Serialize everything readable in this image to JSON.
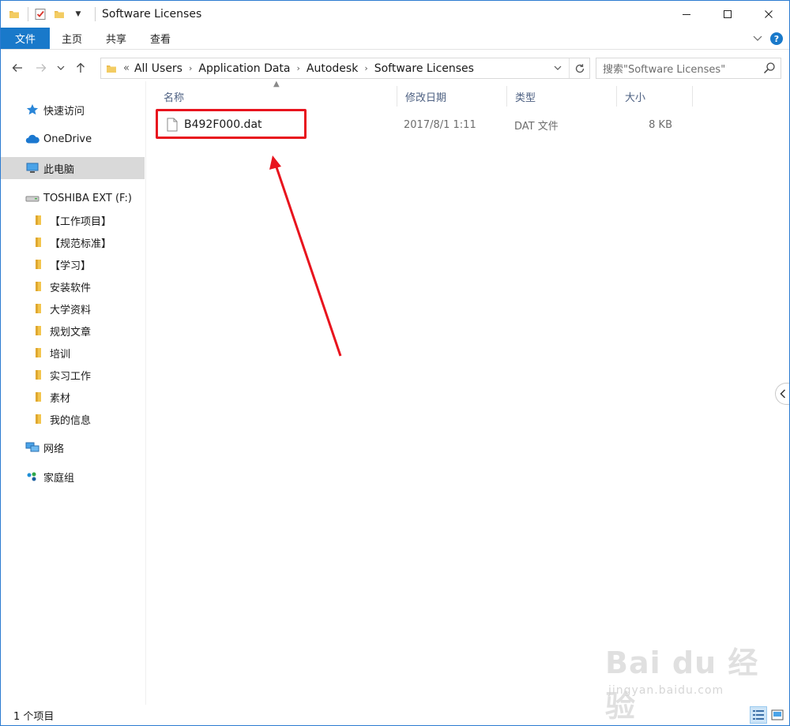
{
  "window": {
    "title": "Software Licenses",
    "controls": [
      "minimize",
      "maximize",
      "close"
    ]
  },
  "ribbon": {
    "tabs": [
      {
        "label": "文件",
        "active": true
      },
      {
        "label": "主页"
      },
      {
        "label": "共享"
      },
      {
        "label": "查看"
      }
    ]
  },
  "address": {
    "overflow": "«",
    "segments": [
      "All Users",
      "Application Data",
      "Autodesk",
      "Software Licenses"
    ]
  },
  "search": {
    "placeholder": "搜索\"Software Licenses\""
  },
  "sidebar": {
    "quick_access": "快速访问",
    "onedrive": "OneDrive",
    "this_pc": "此电脑",
    "drive": "TOSHIBA EXT (F:)",
    "folders": [
      "【工作项目】",
      "【规范标准】",
      "【学习】",
      "安装软件",
      "大学资料",
      "规划文章",
      "培训",
      "实习工作",
      "素材",
      "我的信息"
    ],
    "network": "网络",
    "homegroup": "家庭组"
  },
  "columns": {
    "name": "名称",
    "date": "修改日期",
    "type": "类型",
    "size": "大小"
  },
  "files": [
    {
      "name": "B492F000.dat",
      "date": "2017/8/1 1:11",
      "type": "DAT 文件",
      "size": "8 KB"
    }
  ],
  "status": {
    "count": "1 个项目"
  },
  "watermark": {
    "brand": "Bai du 经验",
    "url": "jingyan.baidu.com"
  },
  "colors": {
    "accent": "#1979ca",
    "highlight": "#e8141e",
    "folder": "#e8b84a",
    "selected": "#d9d9d9"
  }
}
